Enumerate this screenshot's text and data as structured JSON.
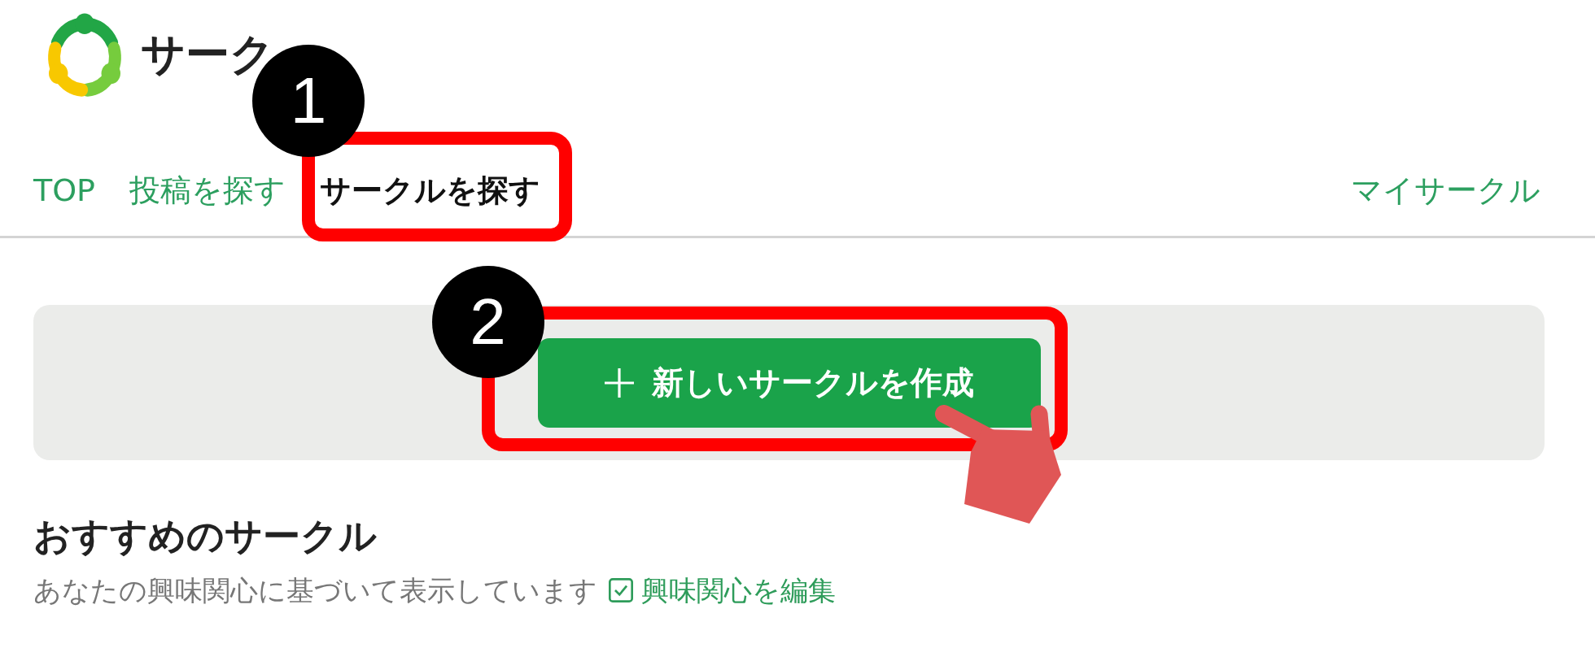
{
  "header": {
    "title": "サーク"
  },
  "tabs": [
    {
      "label": "TOP",
      "selected": false
    },
    {
      "label": "投稿を探す",
      "selected": false
    },
    {
      "label": "サークルを探す",
      "selected": true,
      "callout": "1"
    },
    {
      "label": "マイサークル",
      "selected": false
    }
  ],
  "create_panel": {
    "button": {
      "label": "新しいサークルを作成",
      "callout": "2"
    }
  },
  "recommended": {
    "title": "おすすめのサークル",
    "description": "あなたの興味関心に基づいて表示しています",
    "edit_link": {
      "label": "興味関心を編集"
    }
  }
}
